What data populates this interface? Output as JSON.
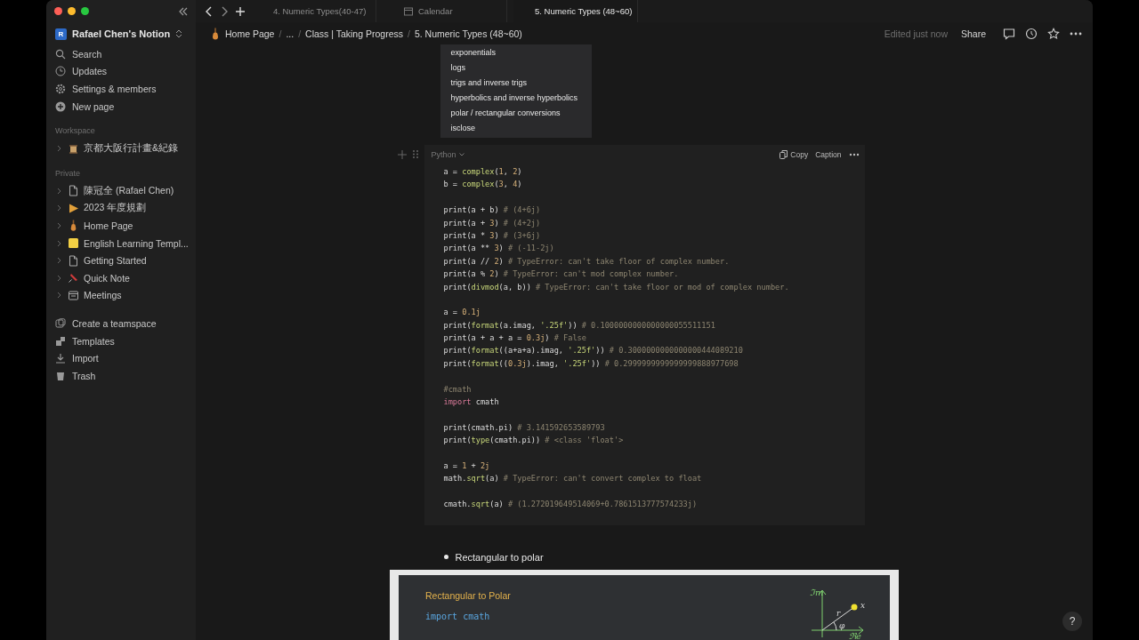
{
  "tabs": [
    {
      "label": "4. Numeric Types(40-47)",
      "selected": false,
      "kind": "page"
    },
    {
      "label": "Calendar",
      "selected": false,
      "kind": "calendar"
    },
    {
      "label": "5. Numeric Types (48~60)",
      "selected": true,
      "kind": "page"
    }
  ],
  "sidebar": {
    "workspace_name": "Rafael Chen's Notion",
    "avatar": "R",
    "actions": [
      {
        "label": "Search",
        "kind": "search"
      },
      {
        "label": "Updates",
        "kind": "clock"
      },
      {
        "label": "Settings & members",
        "kind": "gear"
      },
      {
        "label": "New page",
        "kind": "plus"
      }
    ],
    "sections": [
      {
        "title": "Workspace",
        "items": [
          {
            "label": "京都大阪行計畫&紀錄",
            "kind": "building"
          }
        ]
      },
      {
        "title": "Private",
        "items": [
          {
            "label": "陳冠全 (Rafael Chen)",
            "kind": "page"
          },
          {
            "label": "2023 年度規劃",
            "kind": "triangle"
          },
          {
            "label": "Home Page",
            "kind": "guitar"
          },
          {
            "label": "English Learning Templ...",
            "kind": "note"
          },
          {
            "label": "Getting Started",
            "kind": "page"
          },
          {
            "label": "Quick Note",
            "kind": "pin"
          },
          {
            "label": "Meetings",
            "kind": "calendar"
          }
        ]
      }
    ],
    "footer": [
      {
        "label": "Create a teamspace",
        "kind": "team"
      },
      {
        "label": "Templates",
        "kind": "templates"
      },
      {
        "label": "Import",
        "kind": "import"
      },
      {
        "label": "Trash",
        "kind": "trash"
      }
    ]
  },
  "breadcrumbs": [
    "Home Page",
    "...",
    "Class | Taking Progress",
    "5. Numeric Types (48~60)"
  ],
  "breadcrumb_separator": "/",
  "header": {
    "edited": "Edited just now",
    "share": "Share"
  },
  "slide_list": [
    "exponentials",
    "logs",
    "trigs and inverse trigs",
    "hyperbolics and inverse hyperbolics",
    "polar / rectangular conversions",
    "isclose"
  ],
  "code_block": {
    "language": "Python",
    "copy": "Copy",
    "caption": "Caption",
    "paragraphs": [
      [
        "a = complex(1, 2)",
        "b = complex(3, 4)"
      ],
      [
        "print(a + b) # (4+6j)",
        "print(a + 3) # (4+2j)",
        "print(a * 3) # (3+6j)",
        "print(a ** 3) # (-11-2j)",
        "print(a // 2) # TypeError: can't take floor of complex number.",
        "print(a % 2) # TypeError: can't mod complex number.",
        "print(divmod(a, b)) # TypeError: can't take floor or mod of complex number."
      ],
      [
        "a = 0.1j",
        "print(format(a.imag, '.25f')) # 0.1000000000000000055511151",
        "print(a + a + a = 0.3j) # False",
        "print(format((a+a+a).imag, '.25f')) # 0.3000000000000000444089210",
        "print(format((0.3j).imag, '.25f')) # 0.2999999999999999888977698"
      ],
      [
        "#cmath",
        "import cmath"
      ],
      [
        "print(cmath.pi) # 3.141592653589793",
        "print(type(cmath.pi)) # <class 'float'>"
      ],
      [
        "a = 1 + 2j",
        "math.sqrt(a) # TypeError: can't convert complex to float"
      ],
      [
        "cmath.sqrt(a) # (1.272019649514069+0.7861513777574233j)"
      ]
    ]
  },
  "bullet": "Rectangular to polar",
  "slide": {
    "title": "Rectangular to Polar",
    "code": "import cmath",
    "diagram": {
      "im": "ℑm",
      "re": "ℜe",
      "r": "r",
      "phi": "φ",
      "x": "x"
    }
  },
  "help": "?"
}
